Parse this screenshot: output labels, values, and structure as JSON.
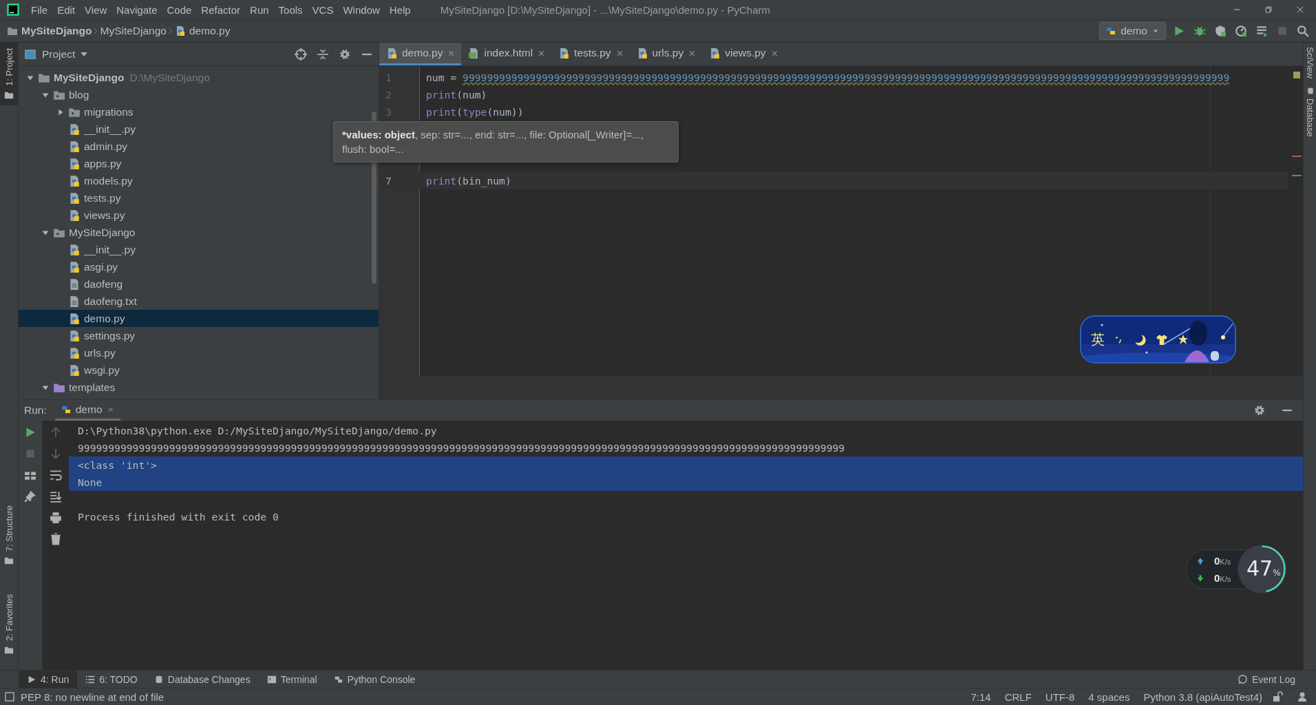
{
  "title_bar": {
    "menu": [
      "File",
      "Edit",
      "View",
      "Navigate",
      "Code",
      "Refactor",
      "Run",
      "Tools",
      "VCS",
      "Window",
      "Help"
    ],
    "title": "MySiteDjango [D:\\MySiteDjango] - ...\\MySiteDjango\\demo.py - PyCharm"
  },
  "nav_bar": {
    "breadcrumbs": [
      {
        "label": "MySiteDjango",
        "kind": "project"
      },
      {
        "label": "MySiteDjango",
        "kind": "folder"
      },
      {
        "label": "demo.py",
        "kind": "python"
      }
    ],
    "run_config": "demo"
  },
  "left_stripe": {
    "top": [
      {
        "label": "1: Project",
        "selected": true
      }
    ],
    "bottom": [
      {
        "label": "7: Structure",
        "selected": false
      },
      {
        "label": "2: Favorites",
        "selected": false
      }
    ]
  },
  "right_stripe": [
    {
      "label": "SciView",
      "selected": false
    },
    {
      "label": "Database",
      "selected": false
    }
  ],
  "project": {
    "title": "Project",
    "tree": [
      {
        "name": "MySiteDjango",
        "path": "D:\\MySiteDjango",
        "kind": "project",
        "expanded": true,
        "selected": false,
        "children": [
          {
            "name": "blog",
            "kind": "package",
            "expanded": true,
            "selected": false,
            "children": [
              {
                "name": "migrations",
                "kind": "package",
                "expanded": false,
                "selected": false
              },
              {
                "name": "__init__.py",
                "kind": "python",
                "selected": false
              },
              {
                "name": "admin.py",
                "kind": "python",
                "selected": false
              },
              {
                "name": "apps.py",
                "kind": "python",
                "selected": false
              },
              {
                "name": "models.py",
                "kind": "python",
                "selected": false
              },
              {
                "name": "tests.py",
                "kind": "python",
                "selected": false
              },
              {
                "name": "views.py",
                "kind": "python",
                "selected": false
              }
            ]
          },
          {
            "name": "MySiteDjango",
            "kind": "package",
            "expanded": true,
            "selected": false,
            "children": [
              {
                "name": "__init__.py",
                "kind": "python",
                "selected": false
              },
              {
                "name": "asgi.py",
                "kind": "python",
                "selected": false
              },
              {
                "name": "daofeng",
                "kind": "text",
                "selected": false
              },
              {
                "name": "daofeng.txt",
                "kind": "text",
                "selected": false
              },
              {
                "name": "demo.py",
                "kind": "python",
                "selected": true
              },
              {
                "name": "settings.py",
                "kind": "python",
                "selected": false
              },
              {
                "name": "urls.py",
                "kind": "python",
                "selected": false
              },
              {
                "name": "wsgi.py",
                "kind": "python",
                "selected": false
              }
            ]
          },
          {
            "name": "templates",
            "kind": "template_folder",
            "expanded": true,
            "selected": false
          }
        ]
      }
    ]
  },
  "editor": {
    "tabs": [
      {
        "label": "demo.py",
        "kind": "python",
        "selected": true
      },
      {
        "label": "index.html",
        "kind": "html",
        "selected": false
      },
      {
        "label": "tests.py",
        "kind": "python",
        "selected": false
      },
      {
        "label": "urls.py",
        "kind": "python",
        "selected": false
      },
      {
        "label": "views.py",
        "kind": "python",
        "selected": false
      }
    ],
    "lines": [
      {
        "number": "1",
        "current": false,
        "tokens": [
          {
            "text": "num = ",
            "kind": "plain"
          },
          {
            "text": "999999999999999999999999999999999999999999999999999999999999999999999999999999999999999999999999999999999999999999999999999999",
            "kind": "number"
          }
        ]
      },
      {
        "number": "2",
        "current": false,
        "tokens": [
          {
            "text": "print",
            "kind": "builtin"
          },
          {
            "text": "(num)",
            "kind": "plain"
          }
        ]
      },
      {
        "number": "3",
        "current": false,
        "tokens": [
          {
            "text": "print",
            "kind": "builtin"
          },
          {
            "text": "(",
            "kind": "plain"
          },
          {
            "text": "type",
            "kind": "builtin"
          },
          {
            "text": "(num))",
            "kind": "plain"
          }
        ]
      },
      {
        "number": "7",
        "current": true,
        "tokens": [
          {
            "text": "print",
            "kind": "builtin"
          },
          {
            "text": "(bin_num)",
            "kind": "plain"
          }
        ]
      }
    ],
    "tooltip": {
      "bold": "*values: object",
      "rest": ", sep: str=..., end: str=..., file: Optional[_Writer]=..., flush: bool=..."
    }
  },
  "run": {
    "label": "Run:",
    "tab": "demo",
    "console": [
      {
        "text": "D:\\Python38\\python.exe D:/MySiteDjango/MySiteDjango/demo.py",
        "selected": false
      },
      {
        "text": "999999999999999999999999999999999999999999999999999999999999999999999999999999999999999999999999999999999999999999999999999999",
        "selected": false
      },
      {
        "text": "<class 'int'>",
        "selected": true
      },
      {
        "text": "None",
        "selected": true
      },
      {
        "text": "Process finished with exit code 0",
        "selected": false,
        "kind": "exit"
      }
    ]
  },
  "tool_tabs": {
    "tabs": [
      {
        "label": "4: Run",
        "kind": "run",
        "selected": true
      },
      {
        "label": "6: TODO",
        "kind": "todo",
        "selected": false
      },
      {
        "label": "Database Changes",
        "kind": "database",
        "selected": false
      },
      {
        "label": "Terminal",
        "kind": "terminal",
        "selected": false
      },
      {
        "label": "Python Console",
        "kind": "python",
        "selected": false
      }
    ],
    "event_log": "Event Log"
  },
  "status_bar": {
    "message": "PEP 8: no newline at end of file",
    "items": [
      "7:14",
      "CRLF",
      "UTF-8",
      "4 spaces",
      "Python 3.8 (apiAutoTest4)"
    ]
  },
  "ime_bar": {
    "label": "英"
  },
  "net_meter": {
    "upload": {
      "value": "0",
      "unit": "K/s"
    },
    "download": {
      "value": "0",
      "unit": "K/s"
    },
    "cpu": {
      "value": "47",
      "unit": "%"
    }
  }
}
